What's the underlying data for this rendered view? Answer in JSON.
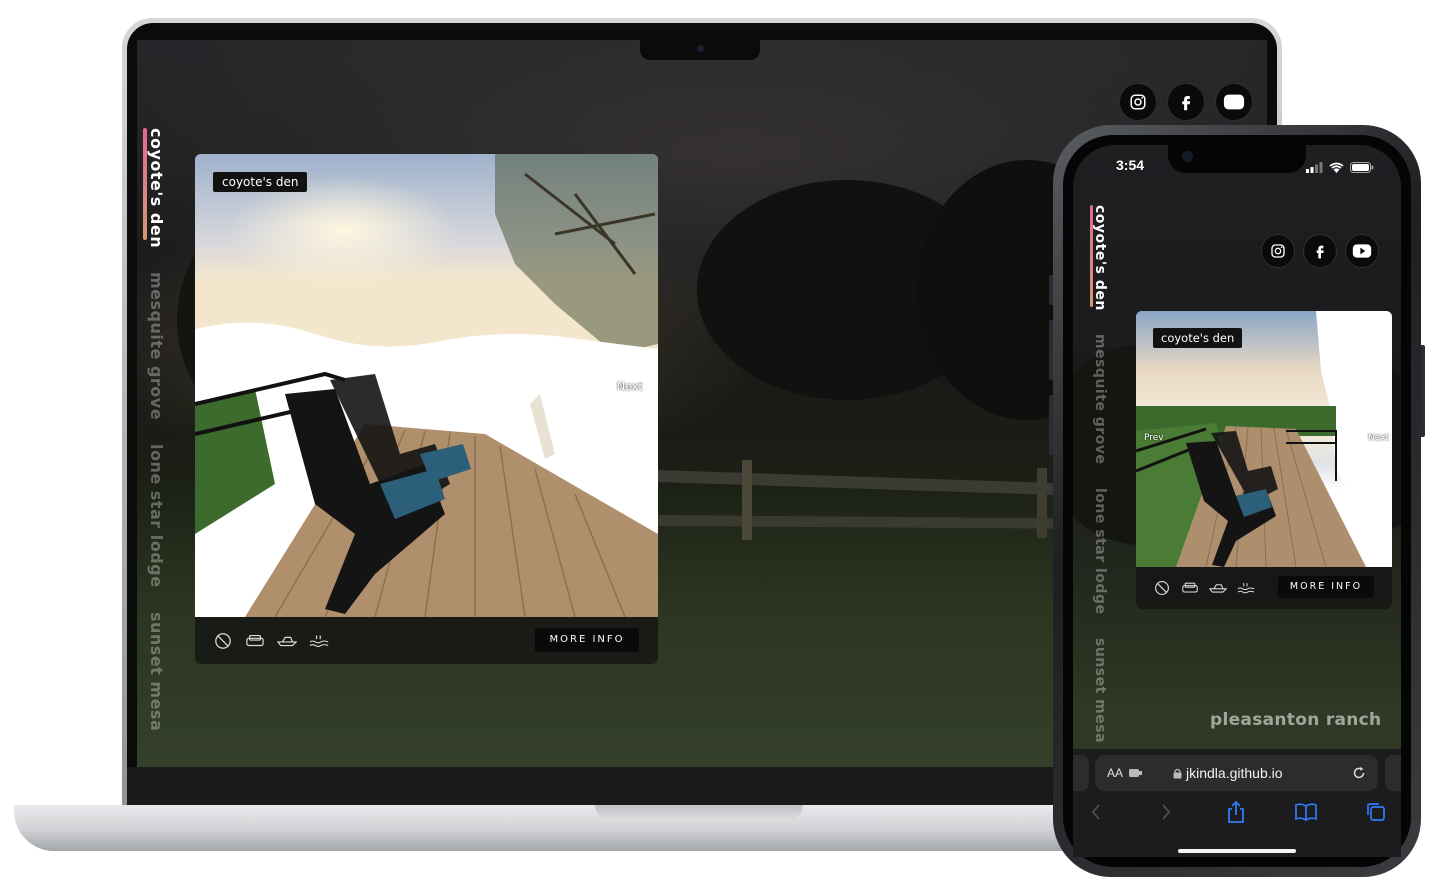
{
  "laptop": {
    "vertical_nav": {
      "active": "coyote's den",
      "items": [
        "mesquite grove",
        "lone star lodge",
        "sunset mesa"
      ]
    },
    "social": [
      "instagram-icon",
      "facebook-icon",
      "youtube-icon"
    ],
    "card": {
      "tag": "coyote's den",
      "next_label": "Next",
      "amenities": [
        "no-smoking-icon",
        "sofa-icon",
        "boat-icon",
        "hot-tub-icon"
      ],
      "more_info": "MORE INFO"
    }
  },
  "phone": {
    "status": {
      "time": "3:54"
    },
    "vertical_nav": {
      "active": "coyote's den",
      "items": [
        "mesquite grove",
        "lone star lodge",
        "sunset mesa"
      ]
    },
    "social": [
      "instagram-icon",
      "facebook-icon",
      "youtube-icon"
    ],
    "card": {
      "tag": "coyote's den",
      "prev_label": "Prev",
      "next_label": "Next",
      "amenities": [
        "no-smoking-icon",
        "sofa-icon",
        "boat-icon",
        "hot-tub-icon"
      ],
      "more_info": "MORE INFO"
    },
    "ranch_name": "pleasanton ranch",
    "browser": {
      "text_size": "AA",
      "url": "jkindla.github.io"
    }
  },
  "colors": {
    "accent_gradient_top": "#e06a8f",
    "accent_gradient_bottom": "#d59a73",
    "safari_link_blue": "#2f7cf6"
  }
}
